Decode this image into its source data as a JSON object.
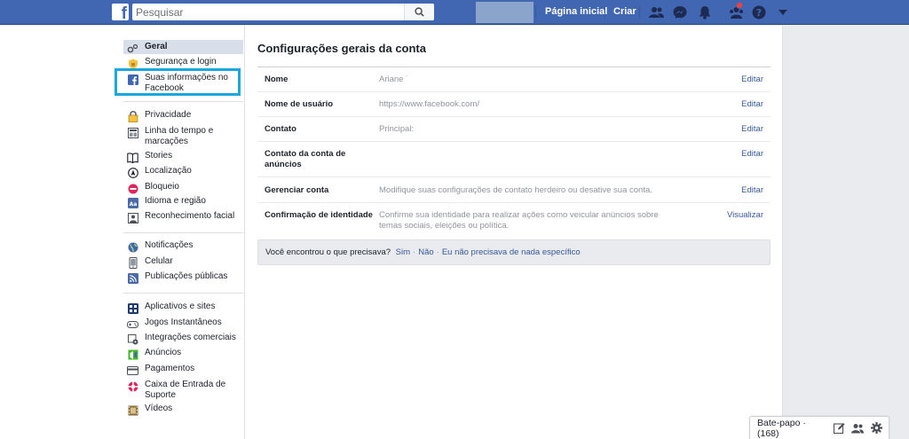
{
  "topbar": {
    "logo": "f",
    "search_placeholder": "Pesquisar",
    "home_label": "Página inicial",
    "create_label": "Criar",
    "icons": [
      "friends-icon",
      "messenger-icon",
      "bell-icon",
      "quick-help-icon",
      "help-icon",
      "dropdown-arrow-icon"
    ]
  },
  "sidebar": {
    "groups": [
      [
        {
          "label": "Geral",
          "icon": "gears-icon",
          "active": true
        },
        {
          "label": "Segurança e login",
          "icon": "badge-icon"
        },
        {
          "label": "Suas informações no Facebook",
          "icon": "facebook-icon",
          "highlighted": true
        }
      ],
      [
        {
          "label": "Privacidade",
          "icon": "lock-icon"
        },
        {
          "label": "Linha do tempo e marcações",
          "icon": "timeline-icon"
        },
        {
          "label": "Stories",
          "icon": "book-icon"
        },
        {
          "label": "Localização",
          "icon": "location-icon"
        },
        {
          "label": "Bloqueio",
          "icon": "block-icon"
        },
        {
          "label": "Idioma e região",
          "icon": "language-icon"
        },
        {
          "label": "Reconhecimento facial",
          "icon": "face-icon"
        }
      ],
      [
        {
          "label": "Notificações",
          "icon": "globe-icon"
        },
        {
          "label": "Celular",
          "icon": "mobile-icon"
        },
        {
          "label": "Publicações públicas",
          "icon": "rss-icon"
        }
      ],
      [
        {
          "label": "Aplicativos e sites",
          "icon": "apps-icon"
        },
        {
          "label": "Jogos Instantâneos",
          "icon": "gamepad-icon"
        },
        {
          "label": "Integrações comerciais",
          "icon": "integrations-icon"
        },
        {
          "label": "Anúncios",
          "icon": "ads-icon"
        },
        {
          "label": "Pagamentos",
          "icon": "card-icon"
        },
        {
          "label": "Caixa de Entrada de Suporte",
          "icon": "lifebuoy-icon"
        },
        {
          "label": "Vídeos",
          "icon": "film-icon"
        }
      ]
    ]
  },
  "main": {
    "title": "Configurações gerais da conta",
    "rows": [
      {
        "label": "Nome",
        "value": "Ariane ˙",
        "action": "Editar"
      },
      {
        "label": "Nome de usuário",
        "value": "https://www.facebook.com/",
        "action": "Editar"
      },
      {
        "label": "Contato",
        "value": "Principal:",
        "action": "Editar"
      },
      {
        "label": "Contato da conta de anúncios",
        "value": "",
        "action": "Editar"
      },
      {
        "label": "Gerenciar conta",
        "value": "Modifique suas configurações de contato herdeiro ou desative sua conta.",
        "action": "Editar"
      },
      {
        "label": "Confirmação de identidade",
        "value": "Confirme sua identidade para realizar ações como veicular anúncios sobre temas sociais, eleições ou política.",
        "action": "Visualizar"
      }
    ],
    "feedback": {
      "question": "Você encontrou o que precisava?",
      "yes": "Sim",
      "no": "Não",
      "nothing": "Eu não precisava de nada específico",
      "separator": "·"
    }
  },
  "chat": {
    "label": "Bate-papo · (168)"
  },
  "colors": {
    "brand": "#4267b2",
    "link": "#365899",
    "highlight": "#1ca6e0",
    "active_bg": "#d8dfea"
  }
}
